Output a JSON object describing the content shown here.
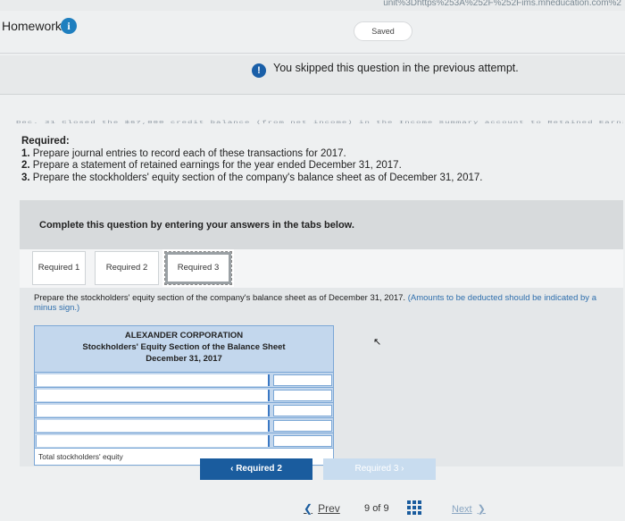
{
  "browser": {
    "url_fragment": "unit%3Dhttps%253A%252F%252Fims.mheducation.com%2"
  },
  "header": {
    "title": "Homework",
    "info_icon": "i",
    "saved_label": "Saved"
  },
  "banner": {
    "icon": "!",
    "message": "You skipped this question in the previous attempt."
  },
  "problem": {
    "clipped_text": "Dec. 31 Closed the $67,000 credit balance (from net income) in the Income Summary account to Retained Earnin",
    "required_heading": "Required:",
    "items": [
      {
        "num": "1.",
        "text": " Prepare journal entries to record each of these transactions for 2017."
      },
      {
        "num": "2.",
        "text": " Prepare a statement of retained earnings for the year ended December 31, 2017."
      },
      {
        "num": "3.",
        "text": " Prepare the stockholders' equity section of the company's balance sheet as of December 31, 2017."
      }
    ]
  },
  "instructions": {
    "complete": "Complete this question by entering your answers in the tabs below."
  },
  "tabs": [
    {
      "label": "Required 1"
    },
    {
      "label": "Required 2"
    },
    {
      "label": "Required 3"
    }
  ],
  "panel": {
    "instruction": "Prepare the stockholders' equity section of the company's balance sheet as of December 31, 2017.",
    "note": "(Amounts to be deducted should be indicated by a minus sign.)"
  },
  "table": {
    "company": "ALEXANDER CORPORATION",
    "subtitle": "Stockholders' Equity Section of the Balance Sheet",
    "date": "December 31, 2017",
    "rows": [
      {
        "label": "",
        "amount": ""
      },
      {
        "label": "",
        "amount": ""
      },
      {
        "label": "",
        "amount": ""
      },
      {
        "label": "",
        "amount": ""
      },
      {
        "label": "",
        "amount": ""
      }
    ],
    "total_label": "Total stockholders' equity"
  },
  "nav_buttons": {
    "prev_tab": "‹ Required 2",
    "next_tab": "Required 3 ›"
  },
  "footer": {
    "prev": "Prev",
    "page": "9",
    "of": "of",
    "total": "9",
    "next": "Next"
  },
  "colors": {
    "primary": "#1a5c9e",
    "table_bg": "#c3d7ed",
    "note": "#2f6fad"
  }
}
